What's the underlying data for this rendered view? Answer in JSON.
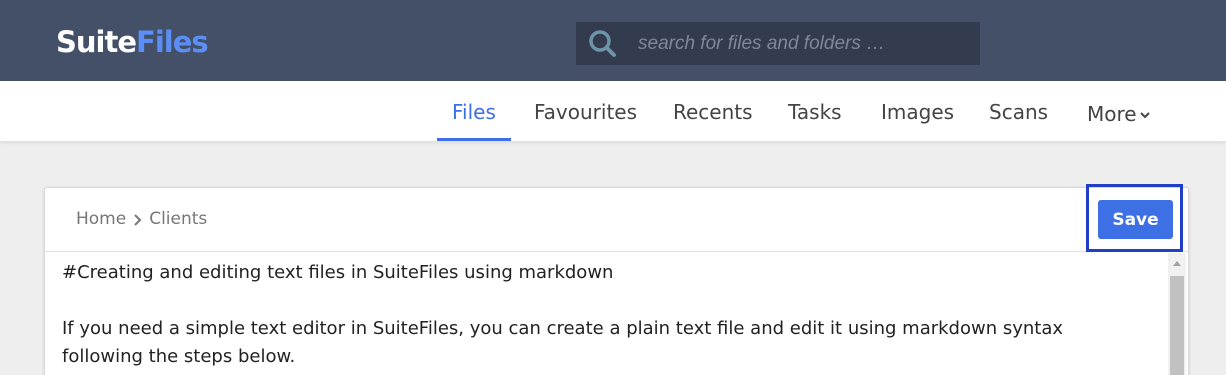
{
  "header": {
    "logo": {
      "part1": "Suite",
      "part2": "Files"
    },
    "search": {
      "placeholder": "search for files and folders …",
      "value": ""
    }
  },
  "nav": {
    "tabs": [
      {
        "label": "Files",
        "active": true
      },
      {
        "label": "Favourites",
        "active": false
      },
      {
        "label": "Recents",
        "active": false
      },
      {
        "label": "Tasks",
        "active": false
      },
      {
        "label": "Images",
        "active": false
      },
      {
        "label": "Scans",
        "active": false
      },
      {
        "label": "More",
        "active": false,
        "icon": "chevron-down-icon"
      }
    ]
  },
  "editor": {
    "breadcrumb": [
      "Home",
      "Clients"
    ],
    "breadcrumb_separator_icon": "chevron-right-icon",
    "save_label": "Save",
    "lines": [
      "#Creating and editing text files in SuiteFiles using markdown",
      "If you need a simple text editor in SuiteFiles, you can create a plain text file and edit it using markdown syntax",
      "following the steps below."
    ]
  },
  "colors": {
    "header_bg": "#435068",
    "search_bg": "#323c4e",
    "accent": "#3d6fe5",
    "highlight_frame": "#1f3fc7"
  }
}
